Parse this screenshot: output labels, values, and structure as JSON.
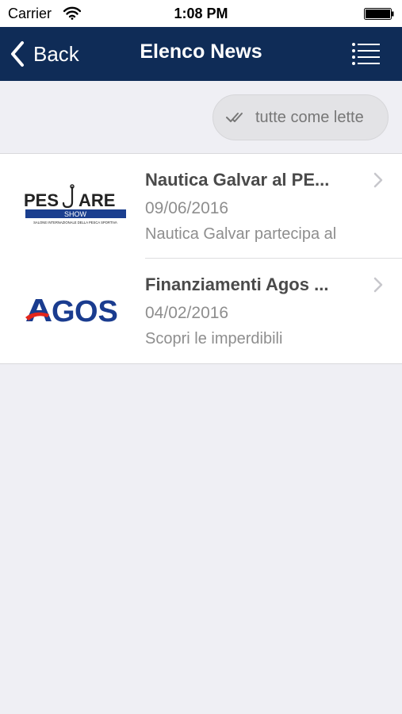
{
  "status_bar": {
    "carrier": "Carrier",
    "time": "1:08 PM"
  },
  "nav": {
    "back_label": "Back",
    "title": "Elenco News"
  },
  "actions": {
    "mark_all_read_label": "tutte come lette"
  },
  "news": [
    {
      "title": "Nautica Galvar al PE...",
      "date": "09/06/2016",
      "snippet": "Nautica Galvar partecipa al",
      "logo": {
        "text_left": "PES",
        "text_right": "ARE",
        "band": "SHOW",
        "tagline": "SALONE INTERNAZIONALE DELLA PESCA SPORTIVA"
      }
    },
    {
      "title": "Finanziamenti Agos ...",
      "date": "04/02/2016",
      "snippet": "Scopri le imperdibili",
      "logo": {
        "text_left": "G",
        "text_right": "OS"
      }
    }
  ],
  "colors": {
    "nav_background": "#0f2c57",
    "page_background": "#efeff4",
    "agos_blue": "#1a3c8f",
    "agos_red": "#e3261c"
  }
}
